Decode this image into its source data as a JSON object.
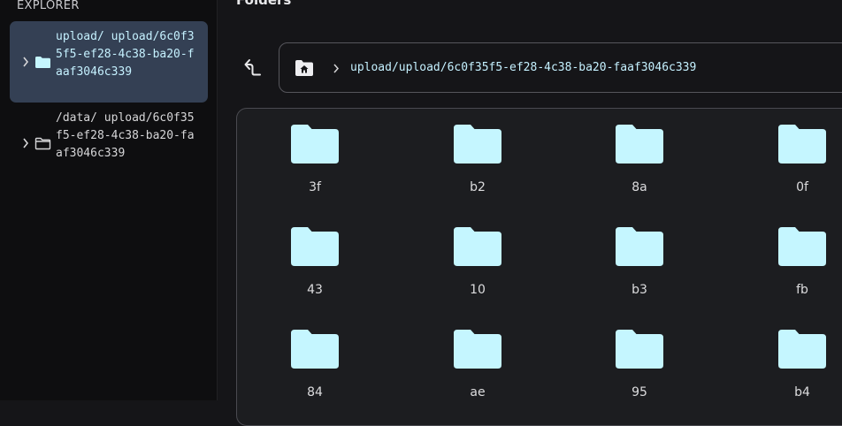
{
  "sidebar": {
    "title": "EXPLORER",
    "items": [
      {
        "label": "upload/ upload/6c0f35f5-ef28-4c38-ba20-faaf3046c339",
        "selected": true,
        "icon": "folder-filled-icon"
      },
      {
        "label": "/data/ upload/6c0f35f5-ef28-4c38-ba20-faaf3046c339",
        "selected": false,
        "icon": "folder-outline-icon"
      }
    ]
  },
  "main": {
    "title": "Folders",
    "up_icon": "arrow-up-left-icon",
    "path": {
      "home_icon": "home-folder-icon",
      "text": "upload/upload/6c0f35f5-ef28-4c38-ba20-faaf3046c339"
    },
    "folders": [
      "3f",
      "b2",
      "8a",
      "0f",
      "43",
      "10",
      "b3",
      "fb",
      "84",
      "ae",
      "95",
      "b4"
    ]
  },
  "colors": {
    "accent": "#c5f1ff",
    "selected_bg": "#344054",
    "folder_fill": "#c5f6ff"
  }
}
